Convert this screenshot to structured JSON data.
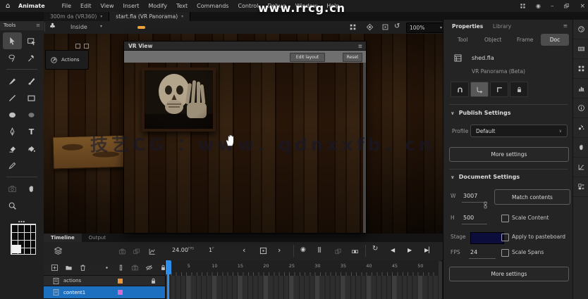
{
  "menubar": {
    "app_name": "Animate",
    "items": [
      "File",
      "Edit",
      "View",
      "Insert",
      "Modify",
      "Text",
      "Commands",
      "Control",
      "Debug",
      "Window",
      "Help"
    ],
    "window_controls": [
      "workspace-icon",
      "record-icon",
      "minimize-icon",
      "restore-icon",
      "close-icon"
    ]
  },
  "document_tabs": [
    {
      "label": "300m da (VR360)",
      "active": false
    },
    {
      "label": "start.fla (VR Panorama)",
      "active": true
    }
  ],
  "edit_bar": {
    "scene_name": "Inside",
    "zoom_value": "100%"
  },
  "watermarks": {
    "top": "www.rrcg.cn",
    "middle": "技艺CG ：www．qdnxxfb．cn"
  },
  "tools": {
    "header": "Tools",
    "items": [
      {
        "icon": "cursor",
        "name": "selection-tool",
        "active": true
      },
      {
        "icon": "subsel",
        "name": "subselection-tool"
      },
      {
        "icon": "lasso",
        "name": "lasso-tool"
      },
      {
        "icon": "pin",
        "name": "fluid-brush-tool"
      },
      {
        "divider": true
      },
      {
        "icon": "brushA",
        "name": "brush-tool"
      },
      {
        "icon": "brush",
        "name": "paint-brush-tool"
      },
      {
        "icon": "lineT",
        "name": "line-tool"
      },
      {
        "icon": "rectT",
        "name": "rectangle-tool"
      },
      {
        "icon": "ovalF",
        "name": "oval-tool"
      },
      {
        "icon": "ovalG",
        "name": "oval-gradient-tool"
      },
      {
        "icon": "pen",
        "name": "pen-tool"
      },
      {
        "glyph": "T",
        "name": "text-tool"
      },
      {
        "icon": "eraser",
        "name": "eraser-tool"
      },
      {
        "icon": "bucket",
        "name": "paint-bucket-tool"
      },
      {
        "icon": "pencil",
        "name": "pencil-tool"
      },
      {
        "spacer": true
      },
      {
        "divider": true
      },
      {
        "icon": "camera",
        "name": "camera-tool",
        "dim": true
      },
      {
        "icon": "hand",
        "name": "hand-tool"
      },
      {
        "icon": "magnifier",
        "name": "zoom-tool"
      },
      {
        "spacer": true
      },
      {
        "glyph": "…",
        "name": "more-tools",
        "wide": true
      }
    ]
  },
  "vr_window": {
    "title": "VR View",
    "button_left": "Edit layout",
    "button_right": "Reset"
  },
  "actions_badge": {
    "label": "Actions"
  },
  "properties": {
    "tabs": [
      {
        "label": "Properties",
        "active": true
      },
      {
        "label": "Library",
        "active": false
      }
    ],
    "subtabs": [
      {
        "label": "Tool"
      },
      {
        "label": "Object"
      },
      {
        "label": "Frame"
      },
      {
        "label": "Doc",
        "active": true
      }
    ],
    "doc_name": "shed.fla",
    "doc_type": "VR Panorama (Beta)",
    "toolbar_icons": [
      "magnet-icon",
      "snap-align-icon",
      "pasteboard-corner-icon",
      "lock-icon"
    ],
    "publish": {
      "title": "Publish Settings",
      "profile_label": "Profile",
      "profile_value": "Default",
      "more_button": "More settings"
    },
    "doc_settings": {
      "title": "Document Settings",
      "w_label": "W",
      "w_value": "3007",
      "h_label": "H",
      "h_value": "500",
      "match_button": "Match contents",
      "scale_content_label": "Scale Content",
      "stage_label": "Stage",
      "stage_color": "#0d0d3c",
      "apply_pasteboard_label": "Apply to pasteboard",
      "fps_label": "FPS",
      "fps_value": "24",
      "scale_spans_label": "Scale Spans",
      "more_button": "More settings"
    }
  },
  "timeline": {
    "tabs": [
      {
        "label": "Timeline",
        "active": true
      },
      {
        "label": "Output",
        "active": false
      }
    ],
    "toolbar": {
      "fps_value": "24.00",
      "fps_unit": "FPS",
      "frame_value": "1",
      "frame_unit": "F"
    },
    "layers": [
      {
        "name": "actions",
        "color": "#e8963c",
        "locked": true,
        "selected": false
      },
      {
        "name": "content1",
        "color": "#d36bd0",
        "locked": false,
        "selected": true
      }
    ],
    "ruler_numbers": [
      5,
      10,
      15,
      20,
      25,
      30,
      35,
      40,
      45,
      50
    ],
    "playhead_frame": 1
  },
  "dock": {
    "icons": [
      {
        "icon": "palette",
        "name": "color-panel-icon"
      },
      {
        "icon": "swatchesic",
        "name": "swatches-panel-icon"
      },
      {
        "icon": "alignic",
        "name": "align-panel-icon"
      },
      {
        "icon": "barsic",
        "name": "transform-panel-icon"
      },
      {
        "icon": "infoic",
        "name": "info-panel-icon"
      },
      {
        "icon": "particles",
        "name": "brush-library-panel-icon"
      },
      {
        "icon": "hand",
        "name": "history-panel-icon"
      },
      {
        "icon": "graphic",
        "name": "motion-presets-panel-icon"
      },
      {
        "icon": "componentsic",
        "name": "components-panel-icon"
      }
    ]
  }
}
